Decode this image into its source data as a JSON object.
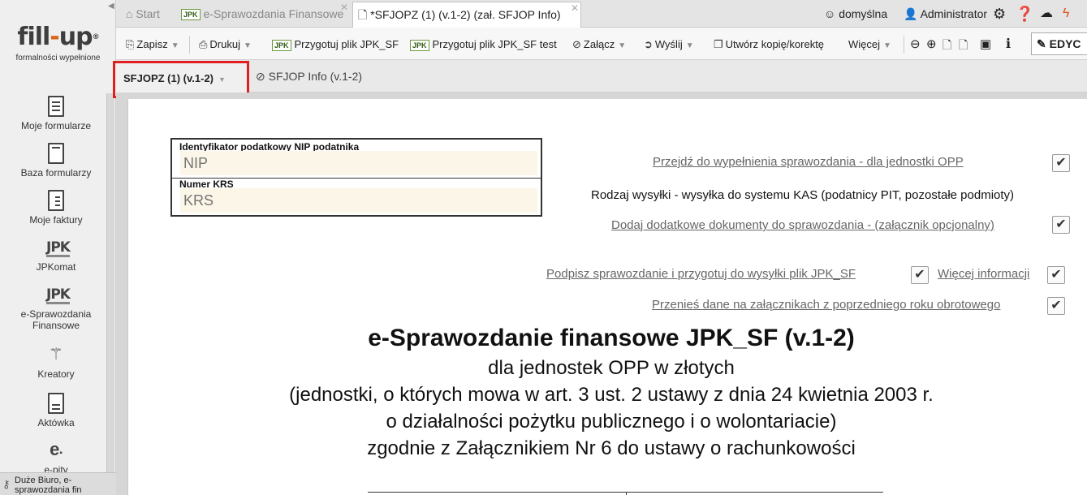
{
  "sidebar": {
    "logo_text_a": "fill",
    "logo_dash": "-",
    "logo_text_b": "up",
    "logo_reg": "®",
    "logo_sub": "formalności wypełnione",
    "items": [
      {
        "label": "Moje formularze",
        "icon": "form-list-icon"
      },
      {
        "label": "Baza formularzy",
        "icon": "form-base-icon"
      },
      {
        "label": "Moje faktury",
        "icon": "invoice-icon"
      },
      {
        "label": "JPKomat",
        "icon": "jpk-icon"
      },
      {
        "label": "e-Sprawozdania Finansowe",
        "icon": "jpk-icon"
      },
      {
        "label": "Kreatory",
        "icon": "wand-icon"
      },
      {
        "label": "Aktówka",
        "icon": "briefcase-icon"
      },
      {
        "label": "e-pity",
        "icon": "epity-icon"
      }
    ],
    "bottom_line1": "Duże Biuro, e-",
    "bottom_line2": "sprawozdania fin"
  },
  "tabs": {
    "start": "Start",
    "esf": "e-Sprawozdania Finansowe",
    "active": "*SFJOPZ (1) (v.1-2) (zał. SFJOP Info)",
    "jpk_badge": "JPK"
  },
  "topbar": {
    "profile": "domyślna",
    "user": "Administrator"
  },
  "toolbar": {
    "save": "Zapisz",
    "print": "Drukuj",
    "prepare": "Przygotuj plik JPK_SF",
    "prepare_test": "Przygotuj plik JPK_SF test",
    "attach": "Załącz",
    "send": "Wyślij",
    "copy": "Utwórz kopię/korektę",
    "more": "Więcej",
    "mode": "EDYC"
  },
  "subtabs": {
    "main": "SFJOPZ (1) (v.1-2)",
    "info": "SFJOP Info (v.1-2)"
  },
  "form": {
    "nip_label": "Identyfikator podatkowy NIP podatnika",
    "nip_placeholder": "NIP",
    "krs_label": "Numer KRS",
    "krs_placeholder": "KRS",
    "link_opp": "Przejdź do wypełnienia sprawozdania - dla jednostki OPP",
    "send_type": "Rodzaj wysyłki - wysyłka do systemu KAS (podatnicy PIT, pozostałe podmioty)",
    "link_docs": "Dodaj dodatkowe dokumenty do sprawozdania - (załącznik opcjonalny)",
    "link_sign": "Podpisz sprawozdanie i przygotuj do wysyłki plik JPK_SF",
    "link_more": "Więcej informacji",
    "link_transfer": "Przenieś dane na załącznikach z poprzedniego roku obrotowego",
    "title": "e-Sprawozdanie finansowe JPK_SF (v.1-2)",
    "line1": "dla jednostek OPP w złotych",
    "line2": "(jednostki, o których mowa w art. 3 ust. 2 ustawy z dnia 24 kwietnia 2003 r.",
    "line3": "o działalności pożytku publicznego i o wolontariacie)",
    "line4": "zgodnie z Załącznikiem Nr 6 do ustawy o rachunkowości"
  }
}
